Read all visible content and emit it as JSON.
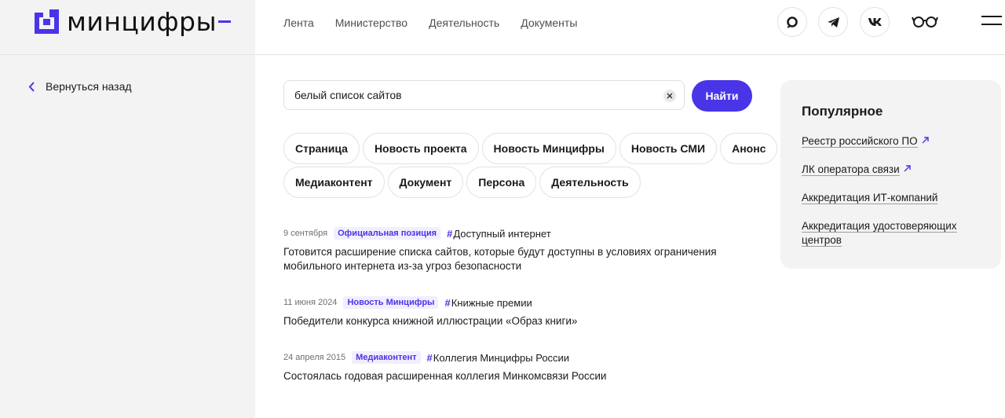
{
  "header": {
    "logo_text": "минцифры",
    "nav": [
      "Лента",
      "Министерство",
      "Деятельность",
      "Документы"
    ],
    "icons": [
      "max-icon",
      "telegram-icon",
      "vk-icon",
      "glasses-icon",
      "menu-icon"
    ]
  },
  "back": {
    "label": "Вернуться назад"
  },
  "search": {
    "value": "белый список сайтов",
    "button_label": "Найти"
  },
  "chips": {
    "row1": [
      "Страница",
      "Новость проекта",
      "Новость Минцифры",
      "Новость СМИ",
      "Анонс"
    ],
    "row2": [
      "Медиаконтент",
      "Документ",
      "Персона",
      "Деятельность"
    ]
  },
  "results": [
    {
      "date": "9 сентября",
      "badge": "Официальная позиция",
      "tag": "Доступный интернет",
      "title_line1": "Готовится расширение списка сайтов, которые будут доступны в условиях ограничения",
      "title_line2": "мобильного интернета из-за угроз безопасности"
    },
    {
      "date": "11 июня 2024",
      "badge": "Новость Минцифры",
      "tag": "Книжные премии",
      "title_line1": "Победители конкурса книжной иллюстрации «Образ книги»"
    },
    {
      "date": "24 апреля 2015",
      "badge": "Медиаконтент",
      "tag": "Коллегия Минцифры России",
      "title_line1": "Состоялась годовая расширенная коллегия Минкомсвязи России"
    }
  ],
  "popular": {
    "title": "Популярное",
    "links": [
      {
        "label": "Реестр российского ПО"
      },
      {
        "label": "ЛК оператора связи"
      },
      {
        "label": "Аккредитация ИТ-компаний"
      },
      {
        "label_line1": "Аккредитация удостоверяющих",
        "label_line2": "центров"
      }
    ]
  },
  "colors": {
    "accent": "#4a34e8",
    "sidebar_bg": "#f3f3f4"
  }
}
